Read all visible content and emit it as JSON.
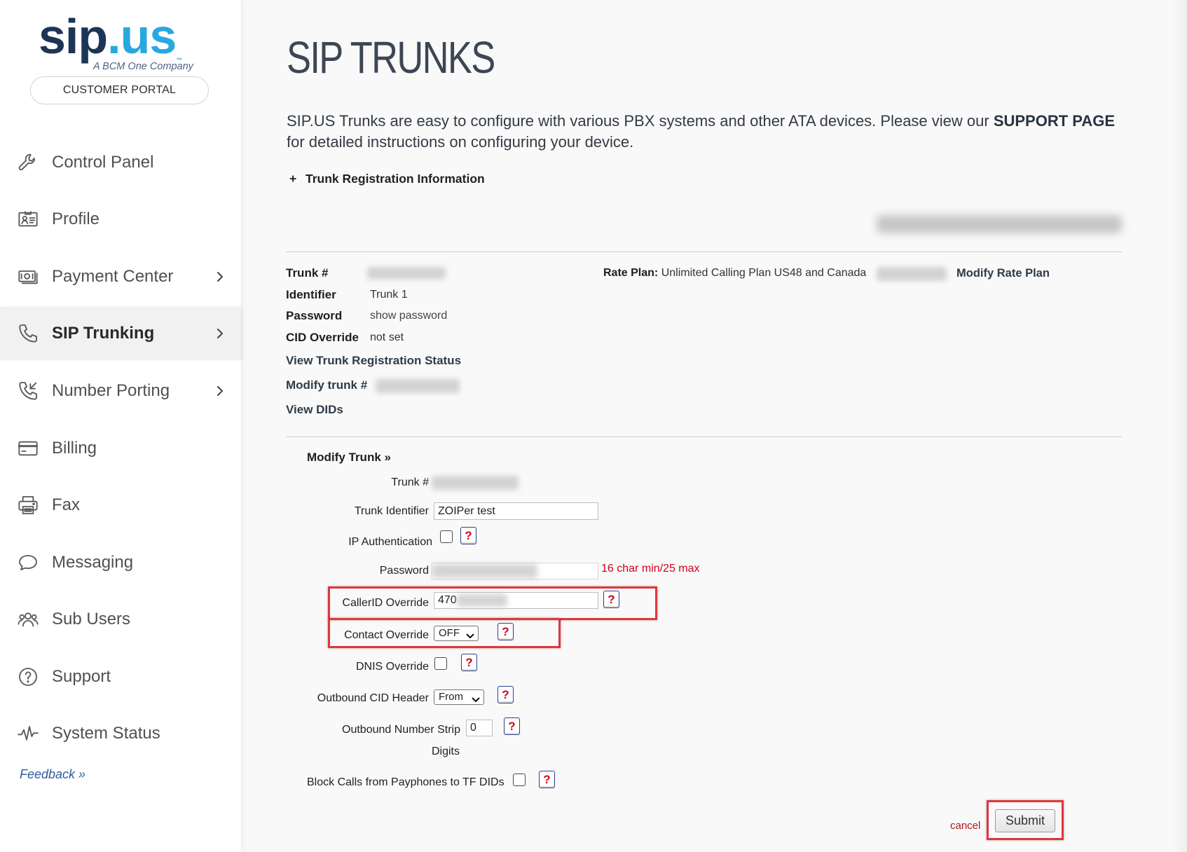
{
  "sidebar": {
    "logo": {
      "sip": "sip",
      "dot": ".",
      "us": "us",
      "tm": "™",
      "tagline": "A BCM One Company"
    },
    "portal_button": "CUSTOMER PORTAL",
    "nav": [
      {
        "label": "Control Panel",
        "icon": "wrench-icon",
        "has_submenu": false,
        "active": false
      },
      {
        "label": "Profile",
        "icon": "id-card-icon",
        "has_submenu": false,
        "active": false
      },
      {
        "label": "Payment Center",
        "icon": "cash-icon",
        "has_submenu": true,
        "active": false
      },
      {
        "label": "SIP Trunking",
        "icon": "phone-icon",
        "has_submenu": true,
        "active": true
      },
      {
        "label": "Number Porting",
        "icon": "phone-incoming-icon",
        "has_submenu": true,
        "active": false
      },
      {
        "label": "Billing",
        "icon": "credit-card-icon",
        "has_submenu": false,
        "active": false
      },
      {
        "label": "Fax",
        "icon": "printer-icon",
        "has_submenu": false,
        "active": false
      },
      {
        "label": "Messaging",
        "icon": "chat-bubble-icon",
        "has_submenu": false,
        "active": false
      },
      {
        "label": "Sub Users",
        "icon": "users-icon",
        "has_submenu": false,
        "active": false
      },
      {
        "label": "Support",
        "icon": "question-circle-icon",
        "has_submenu": false,
        "active": false
      },
      {
        "label": "System Status",
        "icon": "pulse-icon",
        "has_submenu": false,
        "active": false
      }
    ],
    "feedback": "Feedback »"
  },
  "main": {
    "title": "SIP TRUNKS",
    "intro": {
      "text": "SIP.US Trunks are easy to configure with various PBX systems and other ATA devices. Please view our ",
      "link": "SUPPORT PAGE",
      "text2": "for detailed instructions on configuring your device."
    },
    "registration_toggle": {
      "symbol": "+",
      "label": "Trunk Registration Information"
    },
    "trunk_info": {
      "trunk_label": "Trunk #",
      "identifier_label": "Identifier",
      "identifier_value": "Trunk 1",
      "password_label": "Password",
      "password_value": "show password",
      "cid_label": "CID Override",
      "cid_value": "not set",
      "rate_plan_label": "Rate Plan:",
      "rate_plan_value": "Unlimited Calling Plan US48 and Canada",
      "modify_rate_plan": "Modify Rate Plan"
    },
    "links": {
      "view_status": "View Trunk Registration Status",
      "modify_trunk": "Modify trunk #",
      "view_dids": "View DIDs"
    },
    "form": {
      "heading": "Modify Trunk »",
      "help_symbol": "?",
      "trunk_number": {
        "label": "Trunk #"
      },
      "trunk_identifier": {
        "label": "Trunk Identifier",
        "value": "ZOIPer test"
      },
      "ip_authentication": {
        "label": "IP Authentication",
        "checked": false
      },
      "password": {
        "label": "Password",
        "hint": "16 char min/25 max"
      },
      "callerid_override": {
        "label": "CallerID Override",
        "value": "470"
      },
      "contact_override": {
        "label": "Contact Override",
        "selected": "OFF"
      },
      "dnis_override": {
        "label": "DNIS Override",
        "checked": false
      },
      "outbound_cid_header": {
        "label": "Outbound CID Header",
        "selected": "From"
      },
      "outbound_number_strip": {
        "label": "Outbound Number Strip",
        "label2": "Digits",
        "value": "0"
      },
      "block_payphones": {
        "label": "Block Calls from Payphones to TF DIDs",
        "checked": false
      },
      "cancel": "cancel",
      "submit": "Submit"
    }
  },
  "colors": {
    "logo_navy": "#1c3557",
    "logo_cyan": "#29a8e0",
    "highlight_red": "#e2353c",
    "hint_red": "#d0021b",
    "feedback_blue": "#2a5d9f"
  }
}
